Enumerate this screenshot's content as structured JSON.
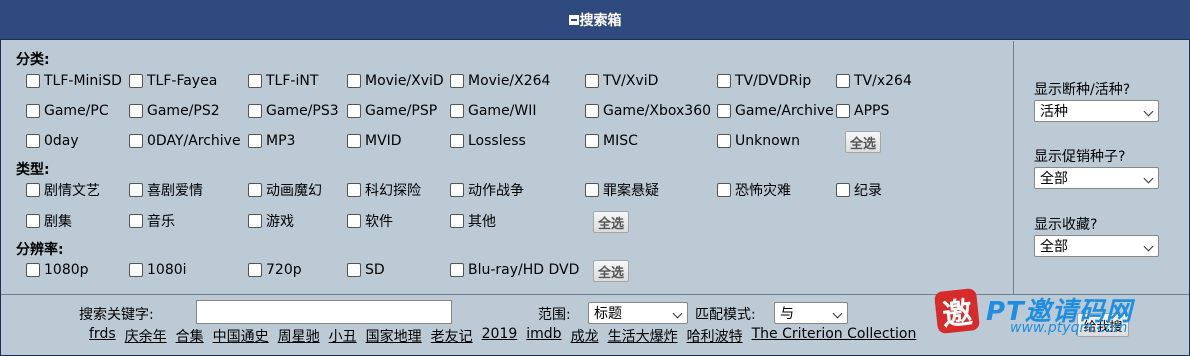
{
  "title": "搜索箱",
  "sections": {
    "category": {
      "label": "分类:",
      "rows": [
        [
          "TLF-MiniSD",
          "TLF-Fayea",
          "TLF-iNT",
          "Movie/XviD",
          "Movie/X264",
          "TV/XviD",
          "TV/DVDRip",
          "TV/x264"
        ],
        [
          "Game/PC",
          "Game/PS2",
          "Game/PS3",
          "Game/PSP",
          "Game/WII",
          "Game/Xbox360",
          "Game/Archive",
          "APPS"
        ],
        [
          "0day",
          "0DAY/Archive",
          "MP3",
          "MVID",
          "Lossless",
          "MISC",
          "Unknown"
        ]
      ],
      "select_all": "全选"
    },
    "type": {
      "label": "类型:",
      "rows": [
        [
          "剧情文艺",
          "喜剧爱情",
          "动画魔幻",
          "科幻探险",
          "动作战争",
          "罪案悬疑",
          "恐怖灾难",
          "纪录"
        ],
        [
          "剧集",
          "音乐",
          "游戏",
          "软件",
          "其他"
        ]
      ],
      "select_all": "全选"
    },
    "resolution": {
      "label": "分辨率:",
      "rows": [
        [
          "1080p",
          "1080i",
          "720p",
          "SD",
          "Blu-ray/HD DVD"
        ]
      ],
      "select_all": "全选"
    }
  },
  "sidebar": {
    "dead": {
      "label": "显示断种/活种?",
      "value": "活种"
    },
    "promo": {
      "label": "显示促销种子?",
      "value": "全部"
    },
    "fav": {
      "label": "显示收藏?",
      "value": "全部"
    }
  },
  "search": {
    "keyword_label": "搜索关键字:",
    "keyword_value": "",
    "scope_label": "范围:",
    "scope_value": "标题",
    "match_label": "匹配模式:",
    "match_value": "与",
    "button_label": "给我搜",
    "hot_links": [
      "frds",
      "庆余年",
      "合集",
      "中国通史",
      "周星驰",
      "小丑",
      "国家地理",
      "老友记",
      "2019",
      "imdb",
      "成龙",
      "生活大爆炸",
      "哈利波特",
      "The Criterion Collection"
    ]
  },
  "watermark": {
    "badge": "邀",
    "title": "PT邀请码网",
    "url": "www.ptyqm.com"
  },
  "colors": {
    "titlebar": "#2f4a7f",
    "panel": "#bccad6",
    "watermark_red": "#d72a2a",
    "watermark_blue": "#1e8fe0"
  }
}
